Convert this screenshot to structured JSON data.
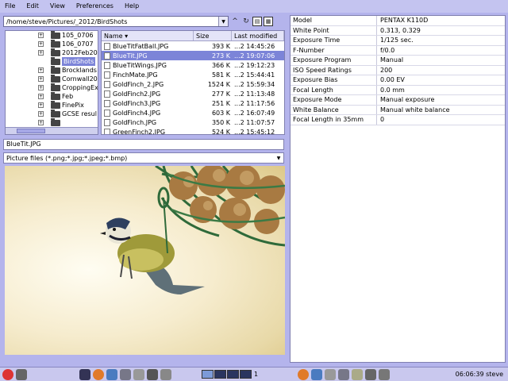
{
  "menu": [
    "File",
    "Edit",
    "View",
    "Preferences",
    "Help"
  ],
  "path": {
    "value": "/home/steve/Pictures/_2012/BirdShots"
  },
  "toolbar": {
    "up": "^",
    "refresh": "↻",
    "bookmark": "▤",
    "grid": "▦"
  },
  "tree": {
    "items": [
      {
        "label": "105_0706",
        "expander": "+",
        "selected": false
      },
      {
        "label": "106_0707",
        "expander": "+",
        "selected": false
      },
      {
        "label": "2012Feb20",
        "expander": "+",
        "selected": false
      },
      {
        "label": "BirdShots",
        "expander": "",
        "selected": true
      },
      {
        "label": "Brocklands",
        "expander": "+",
        "selected": false
      },
      {
        "label": "Cornwall20",
        "expander": "+",
        "selected": false
      },
      {
        "label": "CroppingEx",
        "expander": "+",
        "selected": false
      },
      {
        "label": "Feb",
        "expander": "+",
        "selected": false
      },
      {
        "label": "FinePix",
        "expander": "+",
        "selected": false
      },
      {
        "label": "GCSE resul",
        "expander": "+",
        "selected": false
      },
      {
        "label": "",
        "expander": "+",
        "selected": false
      }
    ]
  },
  "files": {
    "columns": {
      "name": "Name",
      "size": "Size",
      "modified": "Last modified"
    },
    "rows": [
      {
        "name": "BlueTitFatBall.JPG",
        "size": "393 K",
        "date": "...2 14:45:26",
        "selected": false
      },
      {
        "name": "BlueTit.JPG",
        "size": "273 K",
        "date": "...2 19:07:06",
        "selected": true
      },
      {
        "name": "BlueTitWings.JPG",
        "size": "366 K",
        "date": "...2 19:12:23",
        "selected": false
      },
      {
        "name": "FinchMate.JPG",
        "size": "581 K",
        "date": "...2 15:44:41",
        "selected": false
      },
      {
        "name": "GoldFinch_2.JPG",
        "size": "1524 K",
        "date": "...2 15:59:34",
        "selected": false
      },
      {
        "name": "GoldFinch2.JPG",
        "size": "277 K",
        "date": "...2 11:13:48",
        "selected": false
      },
      {
        "name": "GoldFinch3.JPG",
        "size": "251 K",
        "date": "...2 11:17:56",
        "selected": false
      },
      {
        "name": "GoldFinch4.JPG",
        "size": "603 K",
        "date": "...2 16:07:49",
        "selected": false
      },
      {
        "name": "GoldFinch.JPG",
        "size": "350 K",
        "date": "...2 11:07:57",
        "selected": false
      },
      {
        "name": "GreenFinch2.JPG",
        "size": "524 K",
        "date": "...2 15:45:12",
        "selected": false
      }
    ]
  },
  "filename_field": {
    "value": "BlueTit.JPG"
  },
  "filter": {
    "value": "Picture files (*.png;*.jpg;*.jpeg;*.bmp)"
  },
  "exif": [
    {
      "key": "Model",
      "value": "PENTAX K110D"
    },
    {
      "key": "White Point",
      "value": "0.313, 0.329"
    },
    {
      "key": "Exposure Time",
      "value": "1/125 sec."
    },
    {
      "key": "F-Number",
      "value": "f/0.0"
    },
    {
      "key": "Exposure Program",
      "value": "Manual"
    },
    {
      "key": "ISO Speed Ratings",
      "value": "200"
    },
    {
      "key": "Exposure Bias",
      "value": "0.00 EV"
    },
    {
      "key": "Focal Length",
      "value": "0.0 mm"
    },
    {
      "key": "Exposure Mode",
      "value": "Manual exposure"
    },
    {
      "key": "White Balance",
      "value": "Manual white balance"
    },
    {
      "key": "Focal Length in 35mm",
      "value": "0"
    }
  ],
  "taskbar": {
    "workspace_number": "1",
    "clock": "06:06:39",
    "user": "steve"
  },
  "colors": {
    "background": "#b4b4ec",
    "selection": "#7c84d8",
    "panel": "#ffffff"
  }
}
